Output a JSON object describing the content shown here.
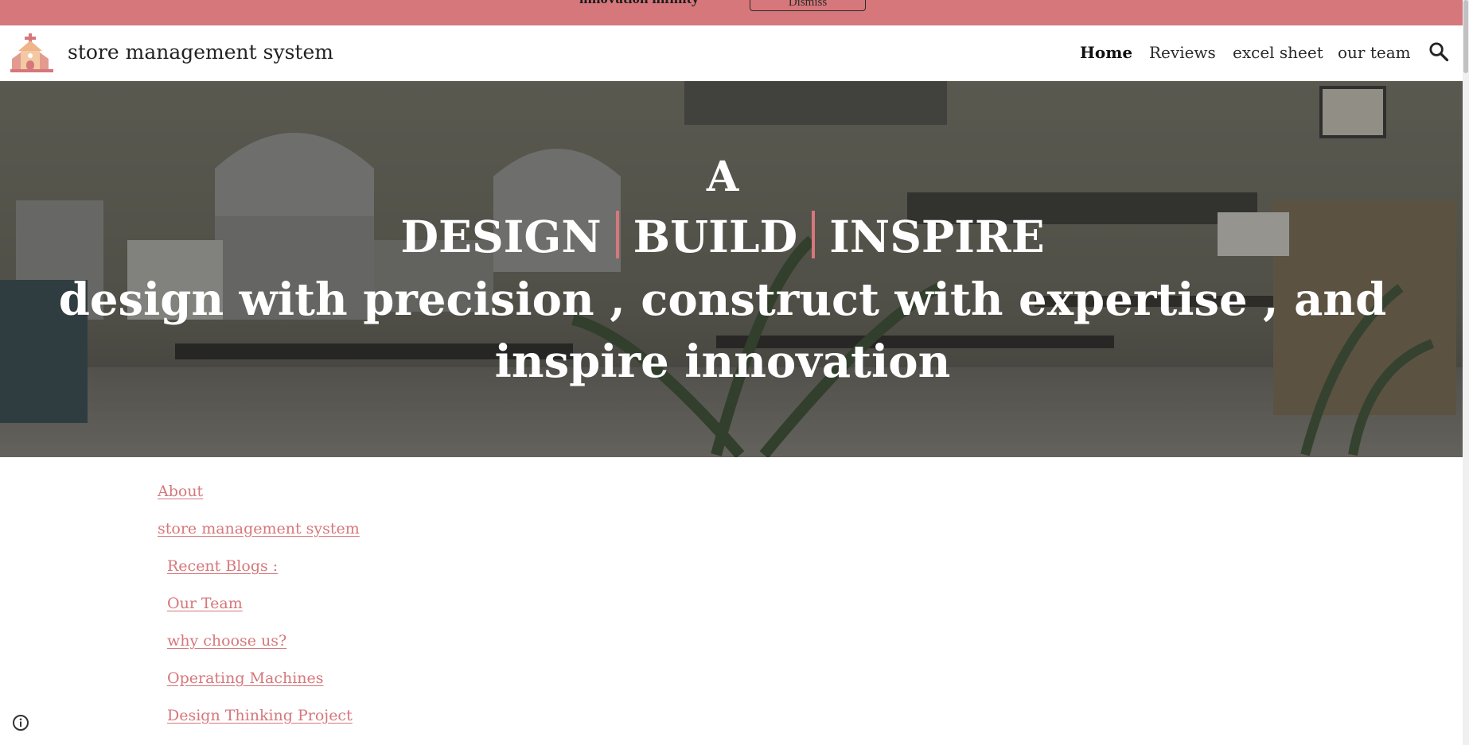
{
  "banner": {
    "text": "innovation infinity",
    "button_label": "Dismiss"
  },
  "header": {
    "site_title": "store management system",
    "logo_icon": "church-icon",
    "nav": [
      {
        "label": "Home",
        "active": true
      },
      {
        "label": "Reviews",
        "active": false
      },
      {
        "label": "excel sheet",
        "active": false
      },
      {
        "label": "our team",
        "active": false
      }
    ],
    "search_icon": "search-icon"
  },
  "hero": {
    "line_a": "A",
    "words": [
      "DESIGN",
      "BUILD",
      "INSPIRE"
    ],
    "tagline_line1": "design with precision , construct with expertise , and",
    "tagline_line2": "inspire innovation"
  },
  "toc": [
    {
      "label": "About"
    },
    {
      "label": "store management system"
    },
    {
      "label": "Recent Blogs :"
    },
    {
      "label": "Our Team"
    },
    {
      "label": "why choose us?"
    },
    {
      "label": "Operating Machines"
    },
    {
      "label": "Design Thinking Project"
    }
  ],
  "footer": {
    "info_icon": "info-icon"
  },
  "colors": {
    "accent": "#d6777b",
    "text": "#222222",
    "hero_text": "#ffffff"
  }
}
